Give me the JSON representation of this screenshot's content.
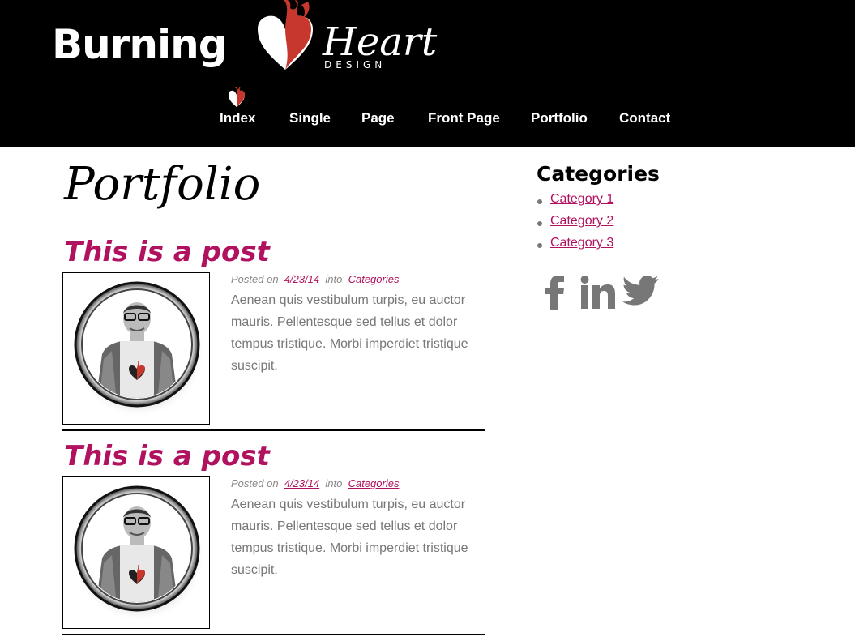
{
  "header": {
    "logo": {
      "word1": "Burning",
      "word2": "Heart",
      "tagline": "DESIGN"
    },
    "nav": [
      {
        "label": "Index"
      },
      {
        "label": "Single"
      },
      {
        "label": "Page"
      },
      {
        "label": "Front Page"
      },
      {
        "label": "Portfolio"
      },
      {
        "label": "Contact"
      }
    ]
  },
  "main": {
    "page_title": "Portfolio",
    "posts": [
      {
        "title": "This is a post",
        "meta_prefix": "Posted on",
        "date": "4/23/14",
        "meta_into": "into",
        "category_link": "Categories",
        "excerpt": "Aenean quis vestibulum turpis, eu auctor mauris. Pellentesque sed tellus et dolor tempus tristique. Morbi imperdiet tristique suscipit."
      },
      {
        "title": "This is a post",
        "meta_prefix": "Posted on",
        "date": "4/23/14",
        "meta_into": "into",
        "category_link": "Categories",
        "excerpt": "Aenean quis vestibulum turpis, eu auctor mauris. Pellentesque sed tellus et dolor tempus tristique. Morbi imperdiet tristique suscipit."
      }
    ]
  },
  "sidebar": {
    "categories_title": "Categories",
    "categories": [
      {
        "label": "Category 1"
      },
      {
        "label": "Category 2"
      },
      {
        "label": "Category 3"
      }
    ],
    "social": [
      {
        "icon": "facebook-icon"
      },
      {
        "icon": "linkedin-icon"
      },
      {
        "icon": "twitter-icon"
      }
    ]
  },
  "colors": {
    "header_bg": "#000000",
    "accent": "#b0125f",
    "logo_red": "#c8372d",
    "text_gray": "#777777"
  }
}
